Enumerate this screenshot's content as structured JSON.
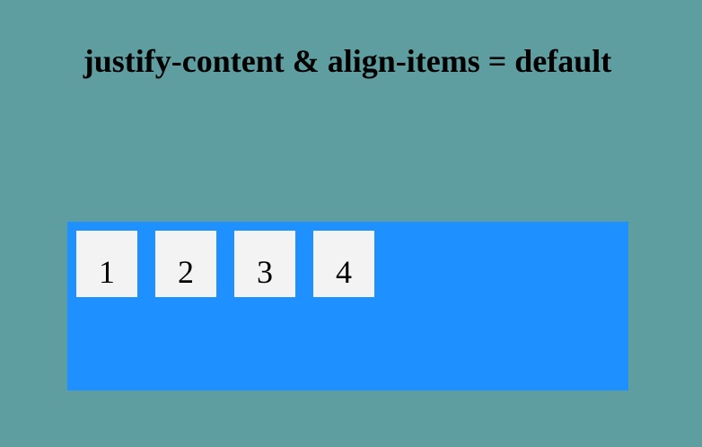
{
  "page": {
    "title": "justify-content & align-items = default"
  },
  "flex_container": {
    "items": [
      {
        "label": "1"
      },
      {
        "label": "2"
      },
      {
        "label": "3"
      },
      {
        "label": "4"
      }
    ]
  },
  "colors": {
    "page_background": "#5f9ea0",
    "container_background": "#1e90ff",
    "item_background": "#f3f3f3",
    "text": "#000000"
  }
}
